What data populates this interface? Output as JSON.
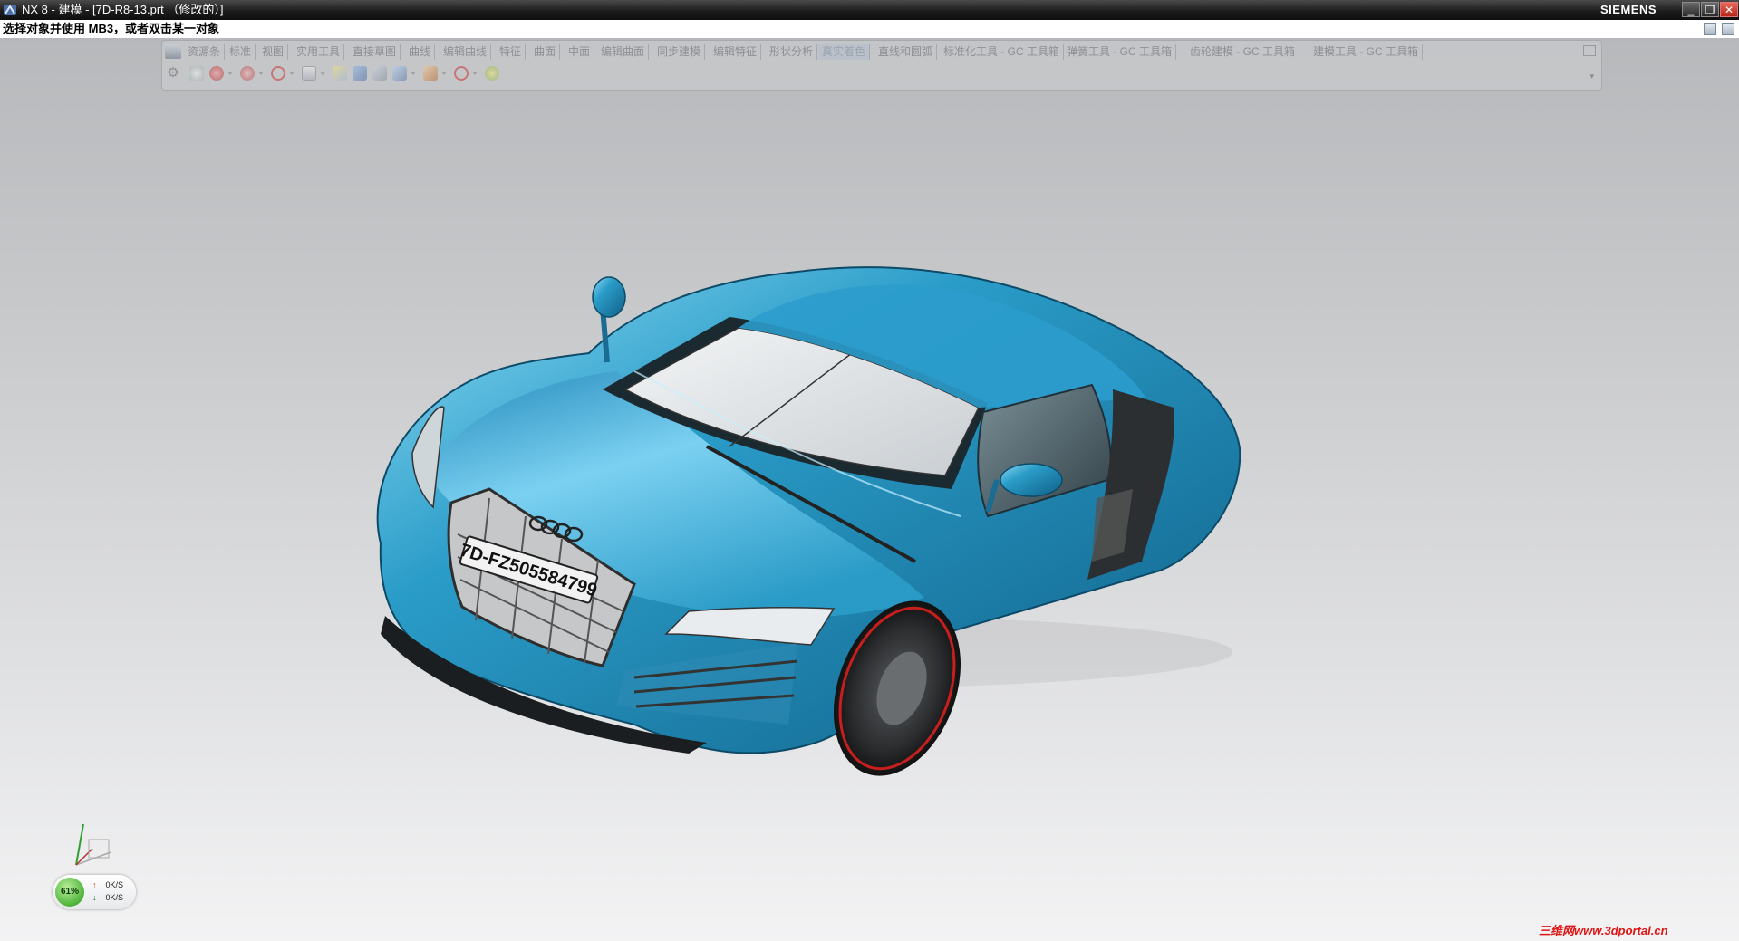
{
  "window": {
    "title": "NX 8 - 建模 - [7D-R8-13.prt （修改的）]",
    "brand": "SIEMENS",
    "minimize_label": "_",
    "restore_label": "❐",
    "close_label": "✕"
  },
  "cue_line": {
    "text": "选择对象并使用 MB3，或者双击某一对象"
  },
  "toolbar": {
    "tabs": [
      {
        "label": "资源条"
      },
      {
        "label": "标准"
      },
      {
        "label": "视图"
      },
      {
        "label": "实用工具"
      },
      {
        "label": "直接草图"
      },
      {
        "label": "曲线"
      },
      {
        "label": "编辑曲线"
      },
      {
        "label": "特征"
      },
      {
        "label": "曲面"
      },
      {
        "label": "中面"
      },
      {
        "label": "编辑曲面"
      },
      {
        "label": "同步建模"
      },
      {
        "label": "编辑特征"
      },
      {
        "label": "形状分析"
      },
      {
        "label": "真实着色"
      },
      {
        "label": "直线和圆弧"
      },
      {
        "label": "标准化工具 - GC 工具箱"
      },
      {
        "label": "弹簧工具 - GC 工具箱"
      },
      {
        "label": "齿轮建模 - GC 工具箱"
      },
      {
        "label": "建模工具 - GC 工具箱"
      }
    ],
    "active_tab": "真实着色"
  },
  "model": {
    "license_plate": "7D-FZ505584799",
    "body_color": "#2a9cc8",
    "body_highlight": "#8fdcf5",
    "body_shadow": "#0f5f86",
    "glass_color": "#e9ecee",
    "wheel_accent": "#c81e1e"
  },
  "net_widget": {
    "percent": "61%",
    "upload": "0K/S",
    "download": "0K/S"
  },
  "watermark": "三维网www.3dportal.cn",
  "colors": {
    "titlebar": "#1d1d1d",
    "toolbar_text": "#8c8f94",
    "background_top": "#b4b6b9",
    "background_bottom": "#f3f3f4"
  }
}
